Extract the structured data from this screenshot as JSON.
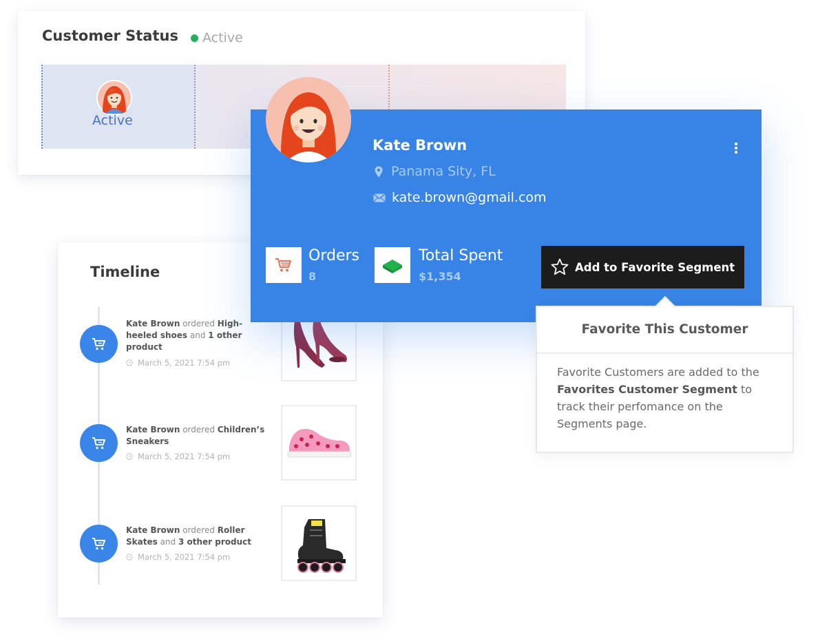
{
  "customer_status": {
    "title": "Customer Status",
    "status": "Active",
    "status_color": "#27ae60",
    "segment_label": "Active"
  },
  "timeline": {
    "title": "Timeline",
    "items": [
      {
        "name": "Kate Brown",
        "verb": "ordered",
        "product": "High-heeled shoes",
        "conj": "and",
        "extra": "1 other product",
        "time": "March 5, 2021 7:54 pm",
        "thumb": "high-heeled-shoes"
      },
      {
        "name": "Kate Brown",
        "verb": "ordered",
        "product": "Children’s Sneakers",
        "conj": "",
        "extra": "",
        "time": "March 5, 2021 7:54 pm",
        "thumb": "childrens-sneakers"
      },
      {
        "name": "Kate Brown",
        "verb": "ordered",
        "product": "Roller Skates",
        "conj": "and",
        "extra": "3 other product",
        "time": "March 5, 2021 7:54 pm",
        "thumb": "roller-skates"
      }
    ]
  },
  "profile": {
    "name": "Kate Brown",
    "location": "Panama Sity, FL",
    "email": "kate.brown@gmail.com",
    "orders_label": "Orders",
    "orders_value": "8",
    "spent_label": "Total Spent",
    "spent_value": "$1,354",
    "favorite_button": "Add to Favorite Segment",
    "accent": "#3784e6"
  },
  "tooltip": {
    "title": "Favorite This Customer",
    "body_1": "Favorite Customers are added to the ",
    "body_bold": "Favorites Customer Segment",
    "body_2": " to track their perfomance on the Segments page."
  }
}
